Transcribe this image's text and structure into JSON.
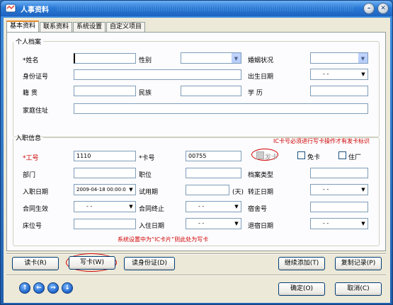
{
  "window": {
    "title": "人事资料"
  },
  "tabs": [
    "基本资料",
    "联系资料",
    "系统设置",
    "自定义项目"
  ],
  "personal": {
    "legend": "个人档案",
    "name_label": "*姓名",
    "name_value": "",
    "gender_label": "性别",
    "marital_label": "婚姻状况",
    "id_label": "身份证号",
    "birth_label": "出生日期",
    "birth_value": "- -",
    "native_label": "籍    贯",
    "ethnic_label": "民族",
    "education_label": "学    历",
    "address_label": "家庭住址"
  },
  "hire": {
    "legend": "入职信息",
    "emp_no_label": "*工号",
    "emp_no_value": "1110",
    "card_no_label": "*卡号",
    "card_no_value": "00755",
    "issue_card_label": "发卡",
    "no_card_label": "免卡",
    "resigned_label": "住厂",
    "dept_label": "部门",
    "position_label": "职位",
    "archive_type_label": "档案类型",
    "hire_date_label": "入职日期",
    "hire_date_value": "2009-04-18 00:00:00",
    "probation_label": "试用期",
    "probation_unit": "(天)",
    "regular_date_label": "转正日期",
    "regular_date_value": "- -",
    "contract_start_label": "合同生效",
    "contract_start_value": "- -",
    "contract_end_label": "合同终止",
    "contract_end_value": "- -",
    "dorm_no_label": "宿舍号",
    "bed_no_label": "床位号",
    "dorm_in_label": "入住日期",
    "dorm_in_value": "- -",
    "dorm_out_label": "退宿日期",
    "dorm_out_value": "- -"
  },
  "annotations": {
    "ic_note": "IC卡号必须进行写卡操作才有发卡标识",
    "write_note": "系统设置中为“IC卡片”则此处为写卡"
  },
  "buttons": {
    "read_card": "读卡(R)",
    "write_card": "写卡(W)",
    "read_id": "读身份证(D)",
    "continue_add": "继续添加(T)",
    "copy_record": "复制记录(P)",
    "ok": "确定(O)",
    "cancel": "取消(C)"
  }
}
